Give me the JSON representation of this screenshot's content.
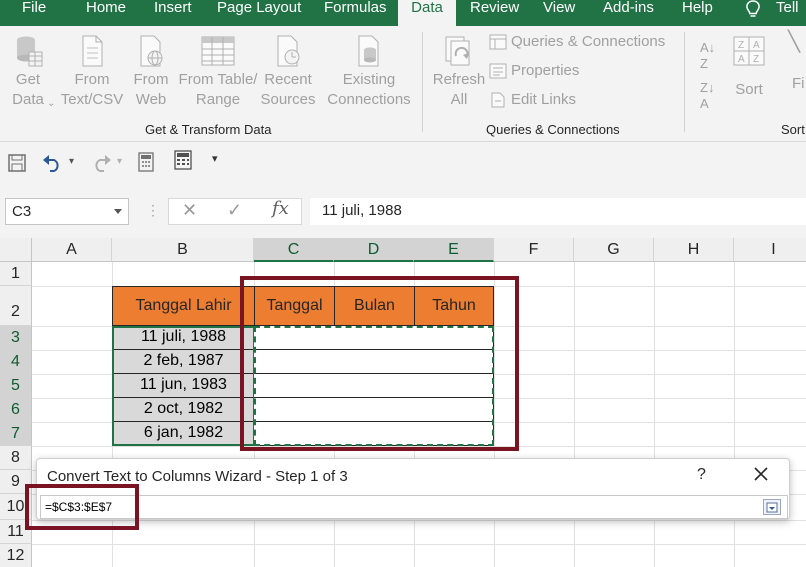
{
  "menu": {
    "tabs": [
      "File",
      "Home",
      "Insert",
      "Page Layout",
      "Formulas",
      "Data",
      "Review",
      "View",
      "Add-ins",
      "Help"
    ],
    "active": "Data",
    "tell_me": "Tell"
  },
  "ribbon": {
    "get_transform": {
      "get_data": [
        "Get",
        "Data"
      ],
      "from_text_csv": [
        "From",
        "Text/CSV"
      ],
      "from_web": [
        "From",
        "Web"
      ],
      "from_table_range": [
        "From Table/",
        "Range"
      ],
      "recent_sources": [
        "Recent",
        "Sources"
      ],
      "existing_connections": [
        "Existing",
        "Connections"
      ],
      "group_label": "Get & Transform Data"
    },
    "queries": {
      "refresh_all": [
        "Refresh",
        "All"
      ],
      "queries_connections": "Queries & Connections",
      "properties": "Properties",
      "edit_links": "Edit Links",
      "group_label": "Queries & Connections"
    },
    "sort_filter": {
      "sort": "Sort",
      "filter": "Fi",
      "group_label": "Sort"
    }
  },
  "formula_bar": {
    "name_box": "C3",
    "formula": "11 juli, 1988",
    "fx": "fx"
  },
  "grid": {
    "columns": [
      "A",
      "B",
      "C",
      "D",
      "E",
      "F",
      "G",
      "H",
      "I"
    ],
    "rows": [
      "1",
      "2",
      "3",
      "4",
      "5",
      "6",
      "7",
      "8",
      "9",
      "10",
      "11",
      "12"
    ],
    "headers": {
      "tanggal_lahir": "Tanggal Lahir",
      "tanggal": "Tanggal",
      "bulan": "Bulan",
      "tahun": "Tahun"
    },
    "dates": [
      "11 juli, 1988",
      "2 feb, 1987",
      "11 jun, 1983",
      "2 oct, 1982",
      "6 jan, 1982"
    ]
  },
  "dialog": {
    "title": "Convert Text to Columns Wizard - Step 1 of 3",
    "help": "?",
    "range_value": "=$C$3:$E$7"
  },
  "colors": {
    "excel_green": "#217346",
    "header_orange": "#ed7d31",
    "highlight_red": "#7b1422",
    "date_cell_gray": "#d9d9d9"
  }
}
